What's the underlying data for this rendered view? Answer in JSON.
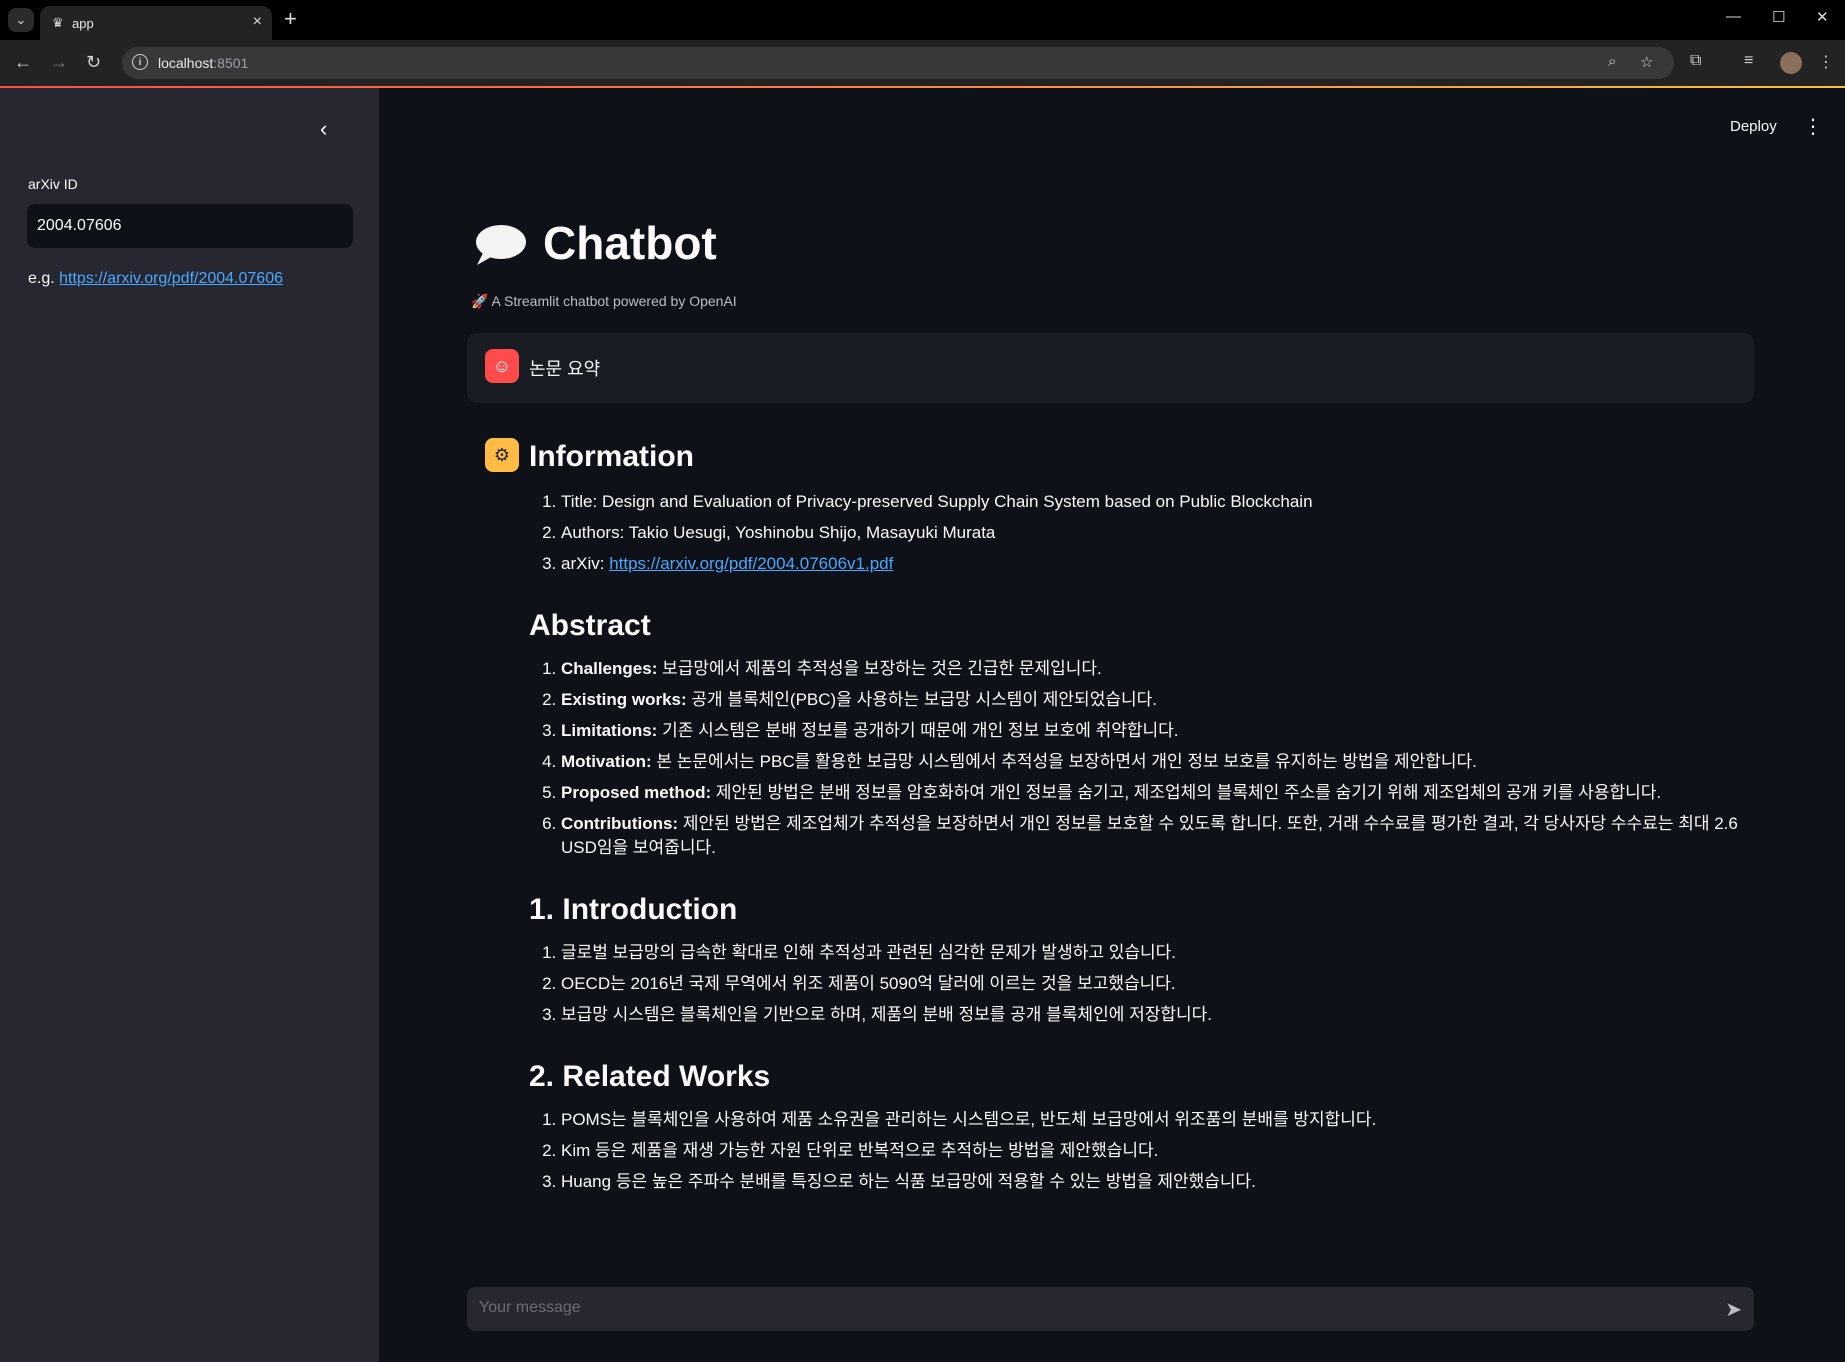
{
  "browser": {
    "tab_title": "app",
    "url_host": "localhost",
    "url_port": ":8501"
  },
  "sidebar": {
    "arxiv_label": "arXiv ID",
    "arxiv_value": "2004.07606",
    "example_prefix": "e.g. ",
    "example_link": "https://arxiv.org/pdf/2004.07606"
  },
  "header": {
    "deploy_label": "Deploy"
  },
  "app": {
    "title": "Chatbot",
    "caption": "🚀 A Streamlit chatbot powered by OpenAI"
  },
  "user_message": "논문 요약",
  "bot_message": {
    "info_heading": "Information",
    "info_items": [
      {
        "prefix": "Title: ",
        "text": "Design and Evaluation of Privacy-preserved Supply Chain System based on Public Blockchain"
      },
      {
        "prefix": "Authors: ",
        "text": "Takio Uesugi, Yoshinobu Shijo, Masayuki Murata"
      },
      {
        "prefix": "arXiv: ",
        "link": "https://arxiv.org/pdf/2004.07606v1.pdf"
      }
    ],
    "abstract_heading": "Abstract",
    "abstract_items": [
      {
        "label": "Challenges:",
        "text": " 보급망에서 제품의 추적성을 보장하는 것은 긴급한 문제입니다."
      },
      {
        "label": "Existing works:",
        "text": " 공개 블록체인(PBC)을 사용하는 보급망 시스템이 제안되었습니다."
      },
      {
        "label": "Limitations:",
        "text": " 기존 시스템은 분배 정보를 공개하기 때문에 개인 정보 보호에 취약합니다."
      },
      {
        "label": "Motivation:",
        "text": " 본 논문에서는 PBC를 활용한 보급망 시스템에서 추적성을 보장하면서 개인 정보 보호를 유지하는 방법을 제안합니다."
      },
      {
        "label": "Proposed method:",
        "text": " 제안된 방법은 분배 정보를 암호화하여 개인 정보를 숨기고, 제조업체의 블록체인 주소를 숨기기 위해 제조업체의 공개 키를 사용합니다."
      },
      {
        "label": "Contributions:",
        "text": " 제안된 방법은 제조업체가 추적성을 보장하면서 개인 정보를 보호할 수 있도록 합니다. 또한, 거래 수수료를 평가한 결과, 각 당사자당 수수료는 최대 2.6 USD임을 보여줍니다."
      }
    ],
    "intro_heading": "1. Introduction",
    "intro_items": [
      "글로벌 보급망의 급속한 확대로 인해 추적성과 관련된 심각한 문제가 발생하고 있습니다.",
      "OECD는 2016년 국제 무역에서 위조 제품이 5090억 달러에 이르는 것을 보고했습니다.",
      "보급망 시스템은 블록체인을 기반으로 하며, 제품의 분배 정보를 공개 블록체인에 저장합니다."
    ],
    "related_heading": "2. Related Works",
    "related_items": [
      "POMS는 블록체인을 사용하여 제품 소유권을 관리하는 시스템으로, 반도체 보급망에서 위조품의 분배를 방지합니다.",
      "Kim 등은 제품을 재생 가능한 자원 단위로 반복적으로 추적하는 방법을 제안했습니다.",
      "Huang 등은 높은 주파수 분배를 특징으로 하는 식품 보급망에 적용할 수 있는 방법을 제안했습니다."
    ]
  },
  "chat_input": {
    "placeholder": "Your message"
  },
  "colors": {
    "background": "#0e1117",
    "sidebar": "#262730",
    "accent_red": "#ff4b4b",
    "accent_yellow": "#ffbd45",
    "link": "#4aa8ff"
  }
}
